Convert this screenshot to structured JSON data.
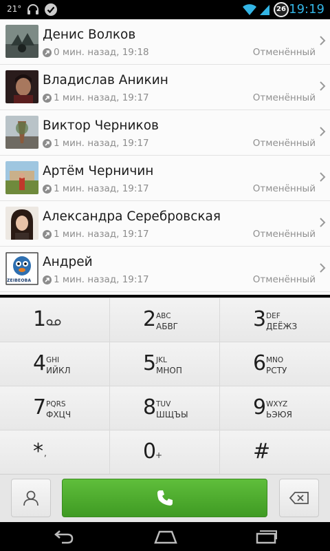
{
  "status_bar": {
    "temperature": "21°",
    "badge": "26",
    "clock": "19:19",
    "clock_color": "#33b5e5",
    "icons": [
      "headphones-icon",
      "checkmark-icon",
      "wifi-icon",
      "signal-icon",
      "battery-circle-icon"
    ]
  },
  "call_log": [
    {
      "name": "Денис Волков",
      "time": "0 мин. назад, 19:18",
      "status": "Отменённый"
    },
    {
      "name": "Владислав Аникин",
      "time": "1 мин. назад, 19:17",
      "status": "Отменённый"
    },
    {
      "name": "Виктор Черников",
      "time": "1 мин. назад, 19:17",
      "status": "Отменённый"
    },
    {
      "name": "Артём Черничин",
      "time": "1 мин. назад, 19:17",
      "status": "Отменённый"
    },
    {
      "name": "Александра Серебровская",
      "time": "1 мин. назад, 19:17",
      "status": "Отменённый"
    },
    {
      "name": "Андрей",
      "time": "1 мин. назад, 19:17",
      "status": "Отменённый",
      "avatar_text": "ZEIBEOBA"
    }
  ],
  "keypad": [
    {
      "digit": "1",
      "letters": "",
      "cyrillic": "",
      "icon": "voicemail-icon"
    },
    {
      "digit": "2",
      "letters": "ABC",
      "cyrillic": "АБВГ"
    },
    {
      "digit": "3",
      "letters": "DEF",
      "cyrillic": "ДЕЁЖЗ"
    },
    {
      "digit": "4",
      "letters": "GHI",
      "cyrillic": "ИЙКЛ"
    },
    {
      "digit": "5",
      "letters": "JKL",
      "cyrillic": "МНОП"
    },
    {
      "digit": "6",
      "letters": "MNO",
      "cyrillic": "РСТУ"
    },
    {
      "digit": "7",
      "letters": "PQRS",
      "cyrillic": "ФХЦЧ"
    },
    {
      "digit": "8",
      "letters": "TUV",
      "cyrillic": "ШЩЪЫ"
    },
    {
      "digit": "9",
      "letters": "WXYZ",
      "cyrillic": "ЬЭЮЯ"
    },
    {
      "digit": "*",
      "letters": ",",
      "cyrillic": ""
    },
    {
      "digit": "0",
      "letters": "+",
      "cyrillic": ""
    },
    {
      "digit": "#",
      "letters": "",
      "cyrillic": ""
    }
  ],
  "actions": {
    "contacts_icon": "person-icon",
    "call_icon": "phone-icon",
    "delete_icon": "backspace-icon",
    "call_color": "#4caf2f"
  },
  "nav": {
    "icons": [
      "back-icon",
      "home-icon",
      "recents-icon"
    ]
  }
}
